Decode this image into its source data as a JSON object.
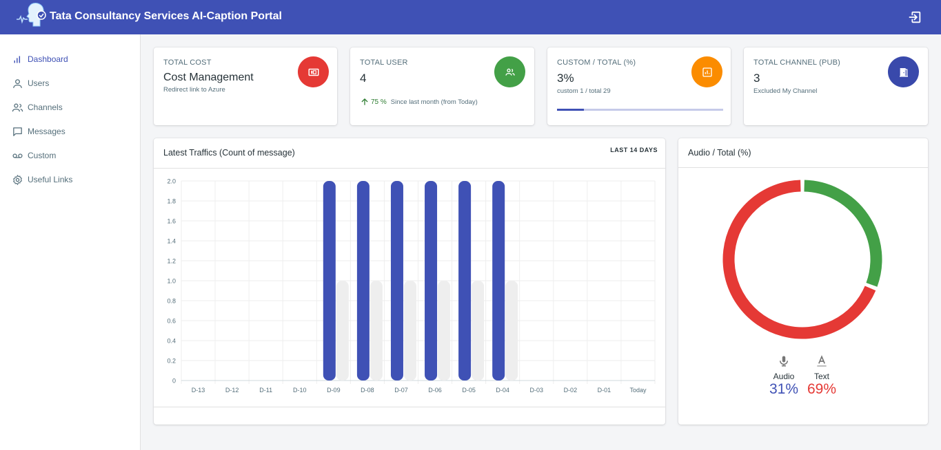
{
  "app": {
    "title": "Tata Consultancy Services AI-Caption Portal"
  },
  "sidebar": {
    "items": [
      {
        "label": "Dashboard",
        "icon": "bar-chart-icon",
        "active": true
      },
      {
        "label": "Users",
        "icon": "user-icon"
      },
      {
        "label": "Channels",
        "icon": "users-icon"
      },
      {
        "label": "Messages",
        "icon": "message-icon"
      },
      {
        "label": "Custom",
        "icon": "voicemail-icon"
      },
      {
        "label": "Useful Links",
        "icon": "gear-icon"
      }
    ]
  },
  "cards": {
    "cost": {
      "label": "TOTAL COST",
      "value": "Cost Management",
      "sub": "Redirect link to Azure",
      "icon": "money-icon",
      "color": "#e53935"
    },
    "users": {
      "label": "TOTAL USER",
      "value": "4",
      "trend_pct": "75 %",
      "trend_text": "Since last month (from Today)",
      "icon": "people-icon",
      "color": "#43a047"
    },
    "custom": {
      "label": "CUSTOM / TOTAL (%)",
      "value": "3%",
      "sub": "custom 1 / total 29",
      "progress": 0.16,
      "icon": "chart-icon",
      "color": "#fb8c00"
    },
    "channel": {
      "label": "TOTAL CHANNEL (PUB)",
      "value": "3",
      "sub": "Excluded My Channel",
      "icon": "door-icon",
      "color": "#3949ab"
    }
  },
  "traffic": {
    "title": "Latest Traffics (Count of message)",
    "action": "LAST 14 DAYS"
  },
  "donut": {
    "title": "Audio / Total (%)",
    "audio_label": "Audio",
    "audio_value": "31%",
    "text_label": "Text",
    "text_value": "69%"
  },
  "chart_data": {
    "type": "bar",
    "categories": [
      "D-13",
      "D-12",
      "D-11",
      "D-10",
      "D-09",
      "D-08",
      "D-07",
      "D-06",
      "D-05",
      "D-04",
      "D-03",
      "D-02",
      "D-01",
      "Today"
    ],
    "series": [
      {
        "values": [
          0,
          0,
          0,
          0,
          2,
          2,
          2,
          2,
          2,
          2,
          0,
          0,
          0,
          0
        ],
        "color": "#3f51b5"
      },
      {
        "values": [
          0,
          0,
          0,
          0,
          1,
          1,
          1,
          1,
          1,
          1,
          0,
          0,
          0,
          0
        ],
        "color": "#eeeeee"
      }
    ],
    "yticks": [
      "0",
      "0.2",
      "0.4",
      "0.6",
      "0.8",
      "1.0",
      "1.2",
      "1.4",
      "1.6",
      "1.8",
      "2.0"
    ],
    "ylim": [
      0,
      2.0
    ],
    "grid": true
  },
  "donut_data": {
    "type": "pie",
    "segments": [
      {
        "name": "Audio",
        "value": 31,
        "color": "#43a047"
      },
      {
        "name": "Text",
        "value": 69,
        "color": "#e53935"
      }
    ]
  }
}
